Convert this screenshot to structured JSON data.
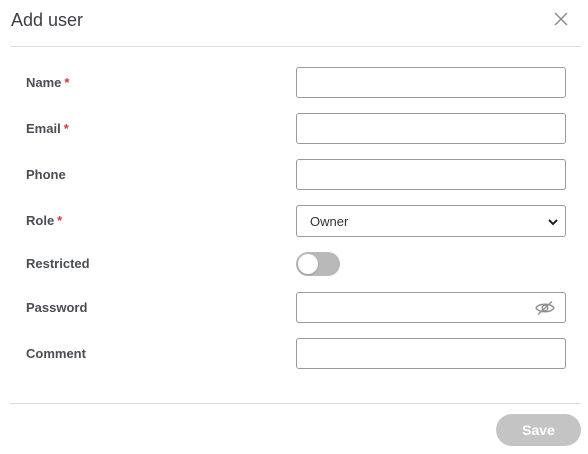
{
  "dialog": {
    "title": "Add user",
    "close_icon": "close-icon"
  },
  "form": {
    "name": {
      "label": "Name",
      "required_mark": "*",
      "value": ""
    },
    "email": {
      "label": "Email",
      "required_mark": "*",
      "value": ""
    },
    "phone": {
      "label": "Phone",
      "value": ""
    },
    "role": {
      "label": "Role",
      "required_mark": "*",
      "selected": "Owner",
      "icon": "chevron-down-icon"
    },
    "restricted": {
      "label": "Restricted",
      "enabled": false
    },
    "password": {
      "label": "Password",
      "value": "",
      "icon": "eye-slash-icon"
    },
    "comment": {
      "label": "Comment",
      "value": ""
    }
  },
  "footer": {
    "save_label": "Save"
  },
  "colors": {
    "required": "#d9363e",
    "save_disabled_bg": "#c4c4c4",
    "toggle_off_bg": "#b9b9b9",
    "input_border": "#9a9a9a"
  }
}
